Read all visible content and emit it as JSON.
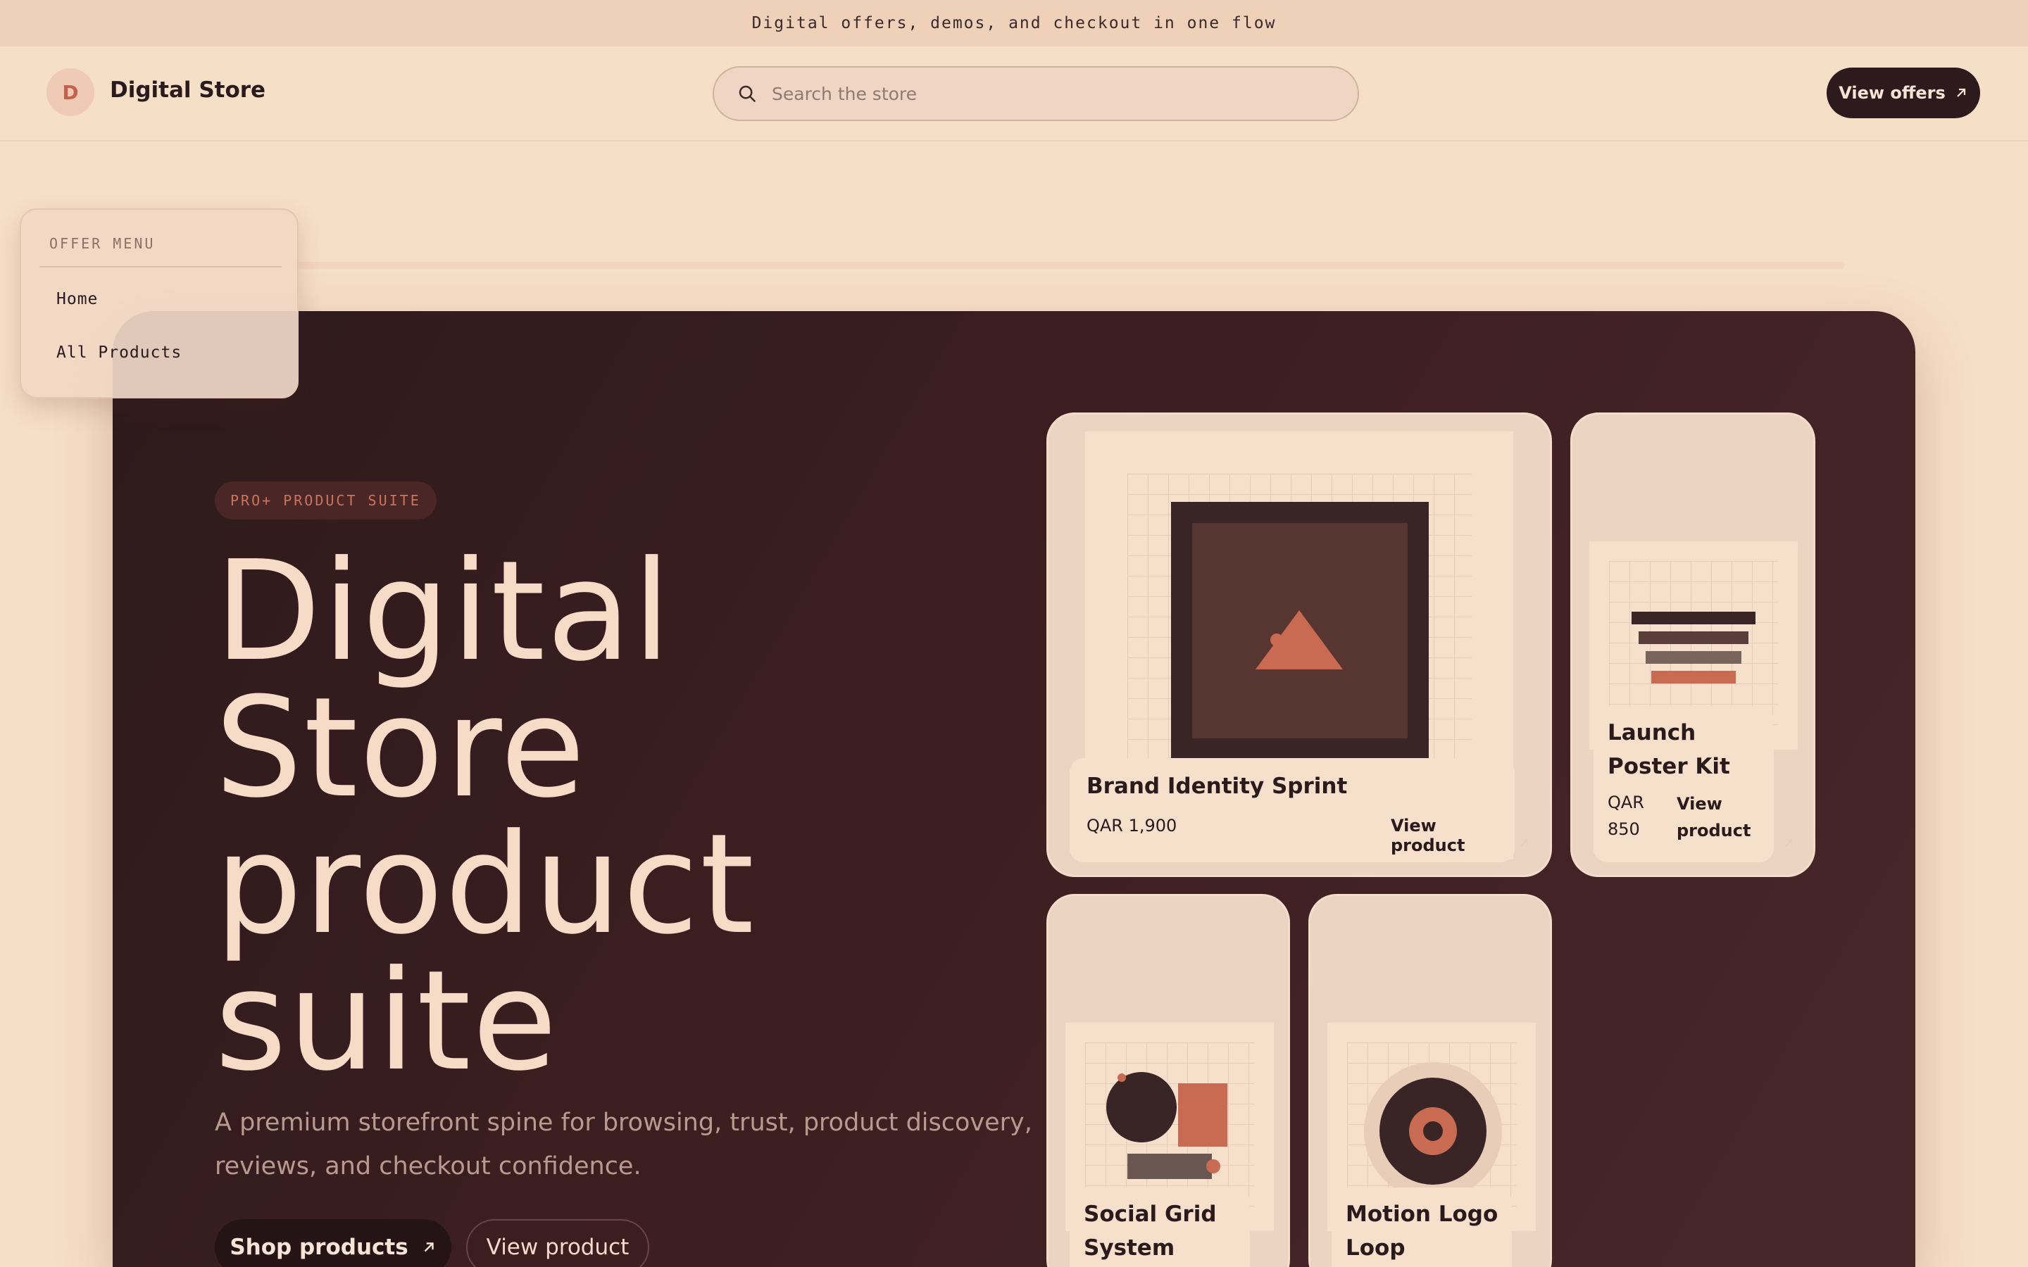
{
  "banner": {
    "text": "Digital offers, demos, and checkout in one flow"
  },
  "header": {
    "logo_letter": "D",
    "brand": "Digital Store",
    "search_placeholder": "Search the store",
    "cta_label": "View offers"
  },
  "offer_menu": {
    "heading": "OFFER MENU",
    "items": [
      {
        "label": "Home"
      },
      {
        "label": "All Products"
      }
    ]
  },
  "hero": {
    "pill": "PRO+ PRODUCT SUITE",
    "title_lines": [
      "Digital",
      "Store",
      "product",
      "suite"
    ],
    "description": "A premium storefront spine for browsing, trust, product discovery, reviews, and checkout confidence.",
    "primary_button": "Shop products",
    "secondary_button": "View product"
  },
  "products": [
    {
      "title": "Brand Identity Sprint",
      "price": "QAR 1,900",
      "link": "View product"
    },
    {
      "title_lines": [
        "Launch",
        "Poster Kit"
      ],
      "price_lines": [
        "QAR",
        "850"
      ],
      "link_lines": [
        "View",
        "product"
      ]
    },
    {
      "title_lines": [
        "Social Grid",
        "System"
      ]
    },
    {
      "title_lines": [
        "Motion Logo",
        "Loop"
      ]
    }
  ],
  "colors": {
    "page_bg": "#f6dfc7",
    "banner_bg": "#efd0b8",
    "hero_bg": "#3e1f21",
    "accent": "#c7604c",
    "dark": "#2c1a1c"
  },
  "icons": {
    "search": "search-icon",
    "arrow": "arrow-up-right-icon"
  }
}
